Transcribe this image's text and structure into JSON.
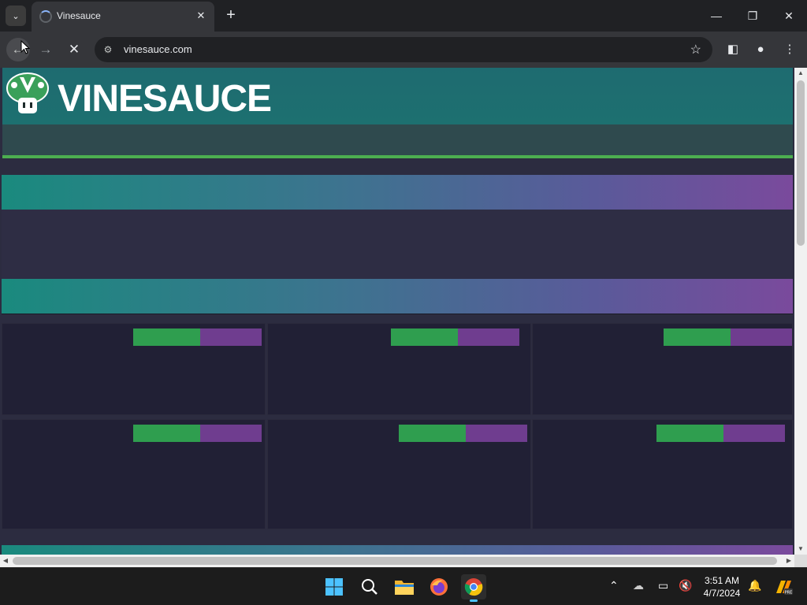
{
  "browser": {
    "tab_title": "Vinesauce",
    "url": "vinesauce.com",
    "icons": [
      "tab-list-icon",
      "loading-spinner-icon",
      "close-icon",
      "plus-icon",
      "minimize-icon",
      "restore-icon",
      "close-window-icon",
      "back-arrow-icon",
      "forward-arrow-icon",
      "stop-icon",
      "site-info-icon",
      "star-icon",
      "side-panel-icon",
      "profile-icon",
      "more-menu-icon"
    ]
  },
  "site": {
    "brand": "VINESAUCE",
    "colors": {
      "header": "#1d6e70",
      "subnav": "#2f4a4e",
      "accent_green": "#4caf50",
      "band_start": "#1a8a7e",
      "band_end": "#7a4a9c",
      "card_bg": "#212035",
      "pill_green": "#2f9e4f",
      "pill_purple": "#6f3d8f"
    },
    "cards": [
      {
        "id": 1
      },
      {
        "id": 2
      },
      {
        "id": 3
      },
      {
        "id": 4
      },
      {
        "id": 5
      },
      {
        "id": 6
      }
    ]
  },
  "taskbar": {
    "apps": [
      "windows-start-icon",
      "search-icon",
      "file-explorer-icon",
      "firefox-icon",
      "chrome-icon"
    ],
    "time": "3:51 AM",
    "date": "4/7/2024",
    "tray_icons": [
      "chevron-up-icon",
      "onedrive-icon",
      "network-icon",
      "volume-muted-icon",
      "notification-bell-icon",
      "copilot-icon"
    ]
  }
}
